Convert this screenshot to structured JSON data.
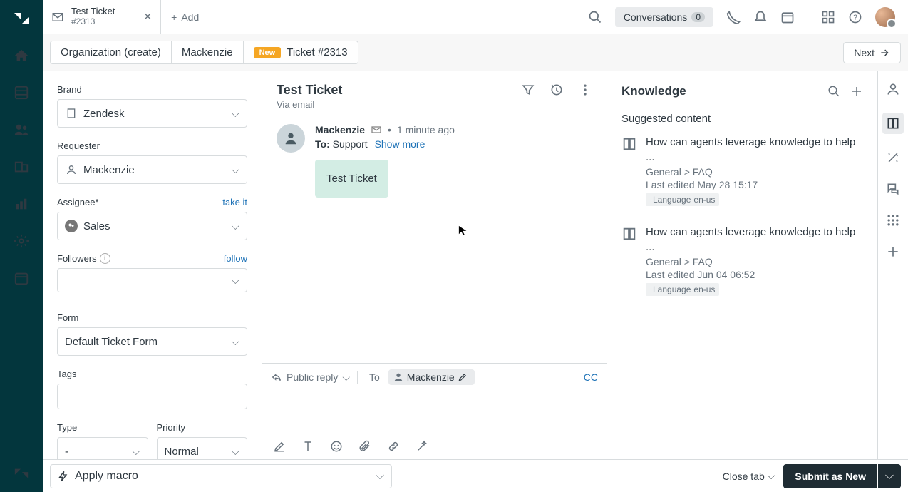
{
  "top": {
    "tab_title": "Test Ticket",
    "tab_sub": "#2313",
    "add_label": "Add",
    "conversations_label": "Conversations",
    "conversations_count": "0"
  },
  "crumbs": {
    "org": "Organization (create)",
    "user": "Mackenzie",
    "badge": "New",
    "ticket": "Ticket #2313",
    "next": "Next"
  },
  "props": {
    "brand_label": "Brand",
    "brand_value": "Zendesk",
    "requester_label": "Requester",
    "requester_value": "Mackenzie",
    "assignee_label": "Assignee*",
    "assignee_link": "take it",
    "assignee_value": "Sales",
    "followers_label": "Followers",
    "followers_link": "follow",
    "form_label": "Form",
    "form_value": "Default Ticket Form",
    "tags_label": "Tags",
    "type_label": "Type",
    "type_value": "-",
    "priority_label": "Priority",
    "priority_value": "Normal"
  },
  "center": {
    "title": "Test Ticket",
    "via": "Via email",
    "msg_name": "Mackenzie",
    "msg_time": "1 minute ago",
    "to_label": "To:",
    "to_value": "Support",
    "show_more": "Show more",
    "bubble": "Test Ticket",
    "reply_label": "Public reply",
    "compose_to_label": "To",
    "pill_name": "Mackenzie",
    "cc": "CC"
  },
  "knowledge": {
    "title": "Knowledge",
    "suggested": "Suggested content",
    "articles": [
      {
        "title": "How can agents leverage knowledge to help ...",
        "breadcrumb": "General > FAQ",
        "edited": "Last edited May 28 15:17",
        "lang_label": "Language",
        "lang_val": "en-us"
      },
      {
        "title": "How can agents leverage knowledge to help ...",
        "breadcrumb": "General > FAQ",
        "edited": "Last edited Jun 04 06:52",
        "lang_label": "Language",
        "lang_val": "en-us"
      }
    ]
  },
  "footer": {
    "macro": "Apply macro",
    "close_tab": "Close tab",
    "submit": "Submit as New"
  }
}
